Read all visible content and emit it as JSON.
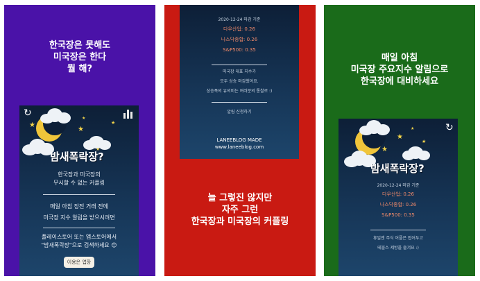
{
  "panel1": {
    "caption": [
      "한국장은 못해도",
      "미국장은 한다",
      "뭘 해?"
    ],
    "app_title": "밤새폭락장?",
    "subtitle": [
      "한국장과 미국장의",
      "무시할 수 없는 커플링"
    ],
    "body": [
      "매일 아침 장전 거래 전에",
      "미국장 지수 알림을 받으시려면"
    ],
    "store": [
      "플레이스토어 또는 앱스토어에서",
      "\"밤새폭락장\"으로 검색하세요 😊"
    ],
    "button": "이용은 앱장"
  },
  "panel2": {
    "date": "2020-12-24 마감 기준",
    "indices": [
      "다우산업: 0.26",
      "나스닥종합: 0.26",
      "S&P500: 0.35"
    ],
    "summary": [
      "미국장 대표 지수가",
      "모두 상승 마감했어요.",
      "상승폭의 유의미는 여러분의 통찰로 :)"
    ],
    "link": "알림 신청하기",
    "made": [
      "LANEEBLOG MADE",
      "www.laneeblog.com"
    ],
    "caption": [
      "늘 그렇진 않지만",
      "자주 그런",
      "한국장과 미국장의 커플링"
    ]
  },
  "panel3": {
    "caption": [
      "매일 아침",
      "미국장 주요지수 알림으로",
      "한국장에 대비하세요"
    ],
    "app_title": "밤새폭락장?",
    "date": "2020-12-24 마감 기준",
    "indices": [
      "다우산업: 0.26",
      "나스닥종합: 0.26",
      "S&P500: 0.35"
    ],
    "summary": [
      "휴일엔 주식 어플은 접어두고",
      "테블스 제방을 즐겨요 :)"
    ]
  },
  "icons": {
    "refresh": "↻"
  },
  "colors": {
    "panel1_bg": "#4a12a8",
    "panel2_bg": "#c91a12",
    "panel3_bg": "#1a6b1a",
    "index_text": "#f08a6a",
    "moon": "#f0c53a"
  }
}
